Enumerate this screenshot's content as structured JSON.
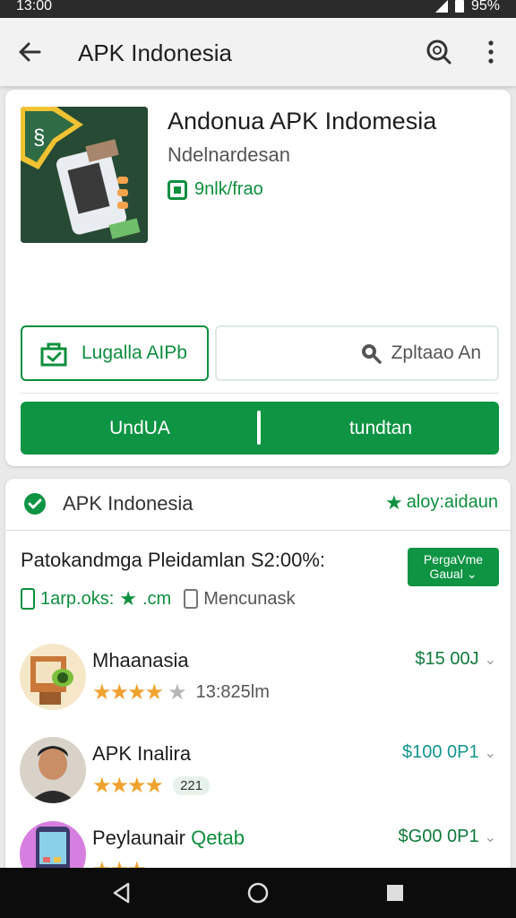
{
  "status": {
    "time": "13:00",
    "battery": "95%"
  },
  "header": {
    "title": "APK Indonesia"
  },
  "app": {
    "name": "Andonua APK Indomesia",
    "developer": "Ndelnardesan",
    "badge": "9nlk/frao"
  },
  "actions": {
    "save_label": "Lugalla AIPb",
    "search_label": "Zpltaao An",
    "download_left": "UndUA",
    "download_right": "tundtan"
  },
  "section": {
    "title": "APK Indonesia",
    "right_label": "aloy:aidaun",
    "promo": "Patokandmga Pleidamlan S2:00%:",
    "select_label": "PergaVme",
    "select_sub": "Gaual",
    "meta_link": "1arp.oks:",
    "meta_link_suffix": ".cm",
    "meta_muted": "Mencunask"
  },
  "list": [
    {
      "name": "Mhaanasia",
      "rating_meta": "13:825lm",
      "price": "$15 00J",
      "price_color": "#0e7a3a"
    },
    {
      "name": "APK Inalira",
      "rating_meta": "221",
      "price": "$100 0P1",
      "price_color": "#14948f"
    },
    {
      "name": "Peylaunair",
      "name_suffix": "Qetab",
      "price": "$G00 0P1",
      "price_color": "#0e7a3a"
    }
  ],
  "colors": {
    "accent": "#0e9443",
    "accent_text": "#0e8f3e"
  }
}
